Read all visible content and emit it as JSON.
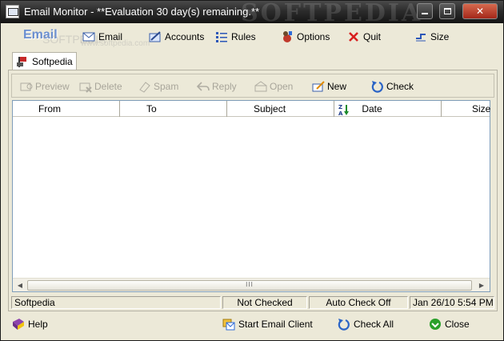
{
  "window": {
    "title": "Email Monitor - **Evaluation 30 day(s) remaining.**",
    "watermark": "SOFTPEDIA",
    "watermark_small": "SOFTPEDIA",
    "watermark_url": "www.softpedia.com"
  },
  "main_tabs": {
    "active_label": "Email",
    "items": [
      {
        "label": "Email",
        "icon": "mail-icon"
      },
      {
        "label": "Accounts",
        "icon": "accounts-icon"
      },
      {
        "label": "Rules",
        "icon": "rules-icon"
      },
      {
        "label": "Options",
        "icon": "options-icon"
      },
      {
        "label": "Quit",
        "icon": "quit-icon"
      },
      {
        "label": "Size",
        "icon": "size-icon"
      }
    ]
  },
  "account_tab": {
    "label": "Softpedia",
    "icon": "mailbox-flag-icon"
  },
  "actions": [
    {
      "label": "Preview",
      "enabled": false,
      "icon": "preview-icon"
    },
    {
      "label": "Delete",
      "enabled": false,
      "icon": "delete-icon"
    },
    {
      "label": "Spam",
      "enabled": false,
      "icon": "spam-icon"
    },
    {
      "label": "Reply",
      "enabled": false,
      "icon": "reply-icon"
    },
    {
      "label": "Open",
      "enabled": false,
      "icon": "open-icon"
    },
    {
      "label": "New",
      "enabled": true,
      "icon": "new-mail-icon"
    },
    {
      "label": "Check",
      "enabled": true,
      "icon": "check-icon"
    }
  ],
  "grid": {
    "columns": [
      "From",
      "To",
      "Subject",
      "Date",
      "Size"
    ],
    "sort_column": "Date",
    "sort_direction": "Z-A",
    "rows": [],
    "scroll_grip": "III"
  },
  "status": {
    "account": "Softpedia",
    "check_state": "Not Checked",
    "auto_check": "Auto Check Off",
    "timestamp": "Jan 26/10 5:54 PM"
  },
  "bottom": {
    "help": "Help",
    "start_client": "Start Email Client",
    "check_all": "Check All",
    "close": "Close"
  },
  "colors": {
    "title_bar": "#2c2c2c",
    "close_button": "#b8341f",
    "accent_link": "#6b8fd0",
    "window_face": "#ece9d8",
    "grid_border": "#7f9db9"
  }
}
